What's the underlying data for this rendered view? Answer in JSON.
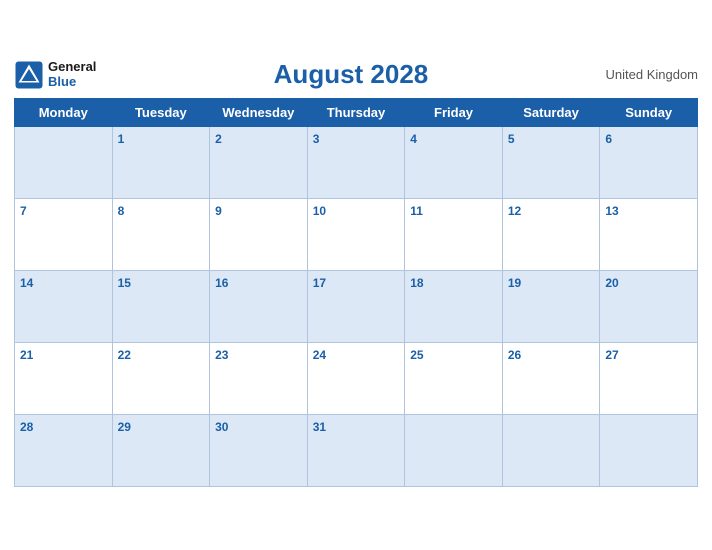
{
  "header": {
    "logo_general": "General",
    "logo_blue": "Blue",
    "title": "August 2028",
    "country": "United Kingdom"
  },
  "weekdays": [
    "Monday",
    "Tuesday",
    "Wednesday",
    "Thursday",
    "Friday",
    "Saturday",
    "Sunday"
  ],
  "weeks": [
    [
      {
        "day": "",
        "empty": true
      },
      {
        "day": "1"
      },
      {
        "day": "2"
      },
      {
        "day": "3"
      },
      {
        "day": "4"
      },
      {
        "day": "5"
      },
      {
        "day": "6"
      }
    ],
    [
      {
        "day": "7"
      },
      {
        "day": "8"
      },
      {
        "day": "9"
      },
      {
        "day": "10"
      },
      {
        "day": "11"
      },
      {
        "day": "12"
      },
      {
        "day": "13"
      }
    ],
    [
      {
        "day": "14"
      },
      {
        "day": "15"
      },
      {
        "day": "16"
      },
      {
        "day": "17"
      },
      {
        "day": "18"
      },
      {
        "day": "19"
      },
      {
        "day": "20"
      }
    ],
    [
      {
        "day": "21"
      },
      {
        "day": "22"
      },
      {
        "day": "23"
      },
      {
        "day": "24"
      },
      {
        "day": "25"
      },
      {
        "day": "26"
      },
      {
        "day": "27"
      }
    ],
    [
      {
        "day": "28"
      },
      {
        "day": "29"
      },
      {
        "day": "30"
      },
      {
        "day": "31"
      },
      {
        "day": "",
        "empty": true
      },
      {
        "day": "",
        "empty": true
      },
      {
        "day": "",
        "empty": true
      }
    ]
  ]
}
